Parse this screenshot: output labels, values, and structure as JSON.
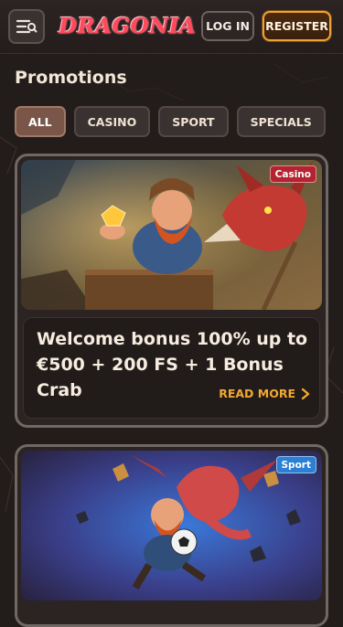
{
  "header": {
    "logo_text": "DRAGONIA",
    "login_label": "LOG IN",
    "register_label": "REGISTER",
    "menu_icon": "menu-search-icon"
  },
  "page": {
    "title": "Promotions"
  },
  "filters": [
    {
      "label": "ALL",
      "active": true
    },
    {
      "label": "CASINO",
      "active": false
    },
    {
      "label": "SPORT",
      "active": false
    },
    {
      "label": "SPECIALS",
      "active": false
    }
  ],
  "promotions": [
    {
      "tag": "Casino",
      "title": "Welcome bonus 100% up to €500 + 200 FS + 1 Bonus Crab",
      "cta": "READ MORE",
      "image": "dwarf-with-gold-and-dragon"
    },
    {
      "tag": "Sport",
      "image": "dwarf-kicking-ball-with-dragon"
    }
  ],
  "colors": {
    "accent": "#f3a930",
    "casino_tag": "#b4232f",
    "sport_tag": "#2b7fd4",
    "background": "#221c1b"
  }
}
